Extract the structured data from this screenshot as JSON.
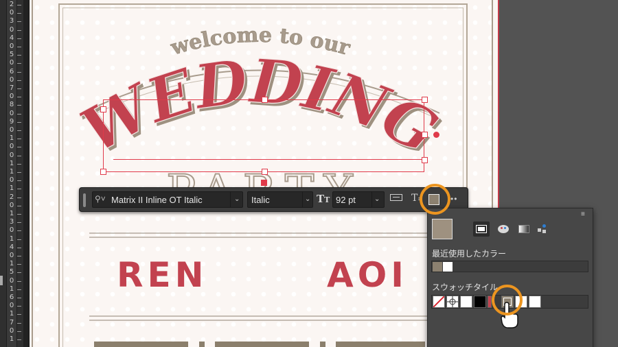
{
  "ruler": {
    "labels": [
      "2",
      "0",
      "3",
      "0",
      "4",
      "0",
      "5",
      "0",
      "6",
      "0",
      "7",
      "0",
      "8",
      "0",
      "9",
      "0",
      "1",
      "0",
      "0",
      "1",
      "1",
      "0",
      "1",
      "2",
      "0",
      "1",
      "3",
      "0",
      "1",
      "4",
      "0",
      "1",
      "5",
      "0",
      "1",
      "6",
      "0",
      "1",
      "7",
      "0",
      "1"
    ]
  },
  "artwork": {
    "headline_top": "welcome to our",
    "headline_main": "WEDDING",
    "headline_sub": "PARTY",
    "name_left": "REN",
    "name_right": "AOI",
    "accent_color": "#c2424f",
    "frame_color": "#a89b8c"
  },
  "taskbar": {
    "font_name": "Matrix II Inline OT Italic",
    "font_style": "Italic",
    "font_size": "92 pt",
    "fill_color": "#8c8170"
  },
  "swatch_panel": {
    "current_color": "#9e9180",
    "recent_label": "最近使用したカラー",
    "recent_colors": [
      "#8c8170",
      "#ffffff"
    ],
    "tiles_label": "スウォッチタイル",
    "tiles": [
      "none",
      "registration",
      "#ffffff",
      "#000000",
      "#c2424f",
      "#8c8170",
      "#ffffff",
      "#ffffff"
    ]
  },
  "highlight_color": "#ec9520"
}
